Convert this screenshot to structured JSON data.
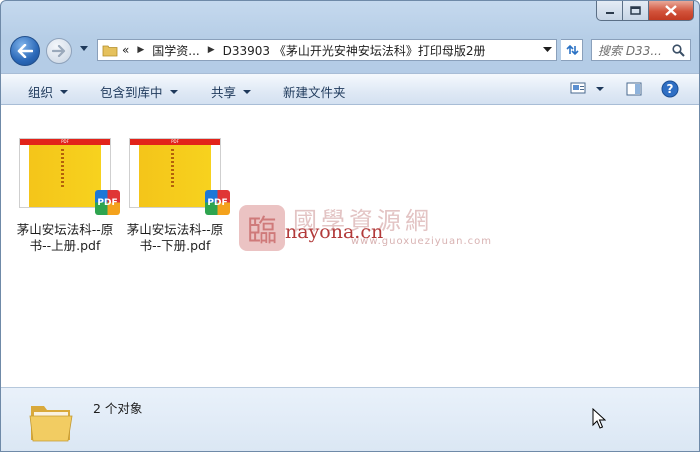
{
  "address_bar": {
    "overflow_chevron": "«",
    "segments": [
      "国学资...",
      "D33903 《茅山开光安神安坛法科》打印母版2册"
    ]
  },
  "search": {
    "placeholder": "搜索 D33..."
  },
  "command_bar": {
    "organize": "组织",
    "include_in_library": "包含到库中",
    "share": "共享",
    "new_folder": "新建文件夹"
  },
  "files": [
    {
      "name": "茅山安坛法科--原书--上册.pdf",
      "type_badge": "PDF",
      "cover_header": "PDF"
    },
    {
      "name": "茅山安坛法科--原书--下册.pdf",
      "type_badge": "PDF",
      "cover_header": "PDF"
    }
  ],
  "watermark": {
    "logo_glyph": "臨",
    "chinese": "國學資源網",
    "domain": "nayona.cn",
    "url": "www.guoxueziyuan.com"
  },
  "details": {
    "item_count": "2 个对象"
  },
  "icons": [
    "back-arrow-icon",
    "forward-arrow-icon",
    "folder-icon",
    "refresh-icon",
    "search-icon",
    "view-icon",
    "preview-pane-icon",
    "help-icon",
    "mouse-cursor-icon"
  ],
  "colors": {
    "accent": "#1e395b",
    "close": "#c23a22",
    "pdf_red": "#e2231a",
    "cover_yellow": "#f4c51a"
  }
}
